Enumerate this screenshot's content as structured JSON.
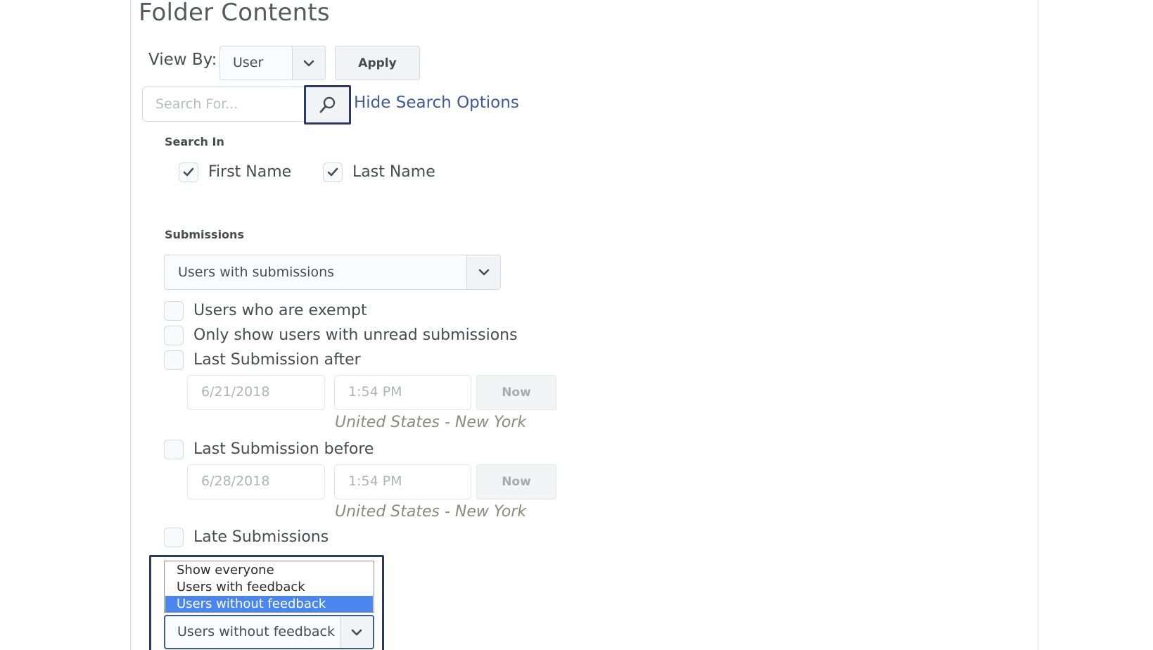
{
  "page": {
    "title": "Folder Contents"
  },
  "view_by": {
    "label": "View By:",
    "selected": "User",
    "apply_label": "Apply"
  },
  "search": {
    "placeholder": "Search For...",
    "hide_options_label": "Hide Search Options"
  },
  "search_in": {
    "label": "Search In",
    "options": [
      {
        "label": "First Name",
        "checked": true
      },
      {
        "label": "Last Name",
        "checked": true
      }
    ]
  },
  "submissions": {
    "label": "Submissions",
    "selected": "Users with submissions"
  },
  "filters": {
    "exempt_label": "Users who are exempt",
    "unread_label": "Only show users with unread submissions",
    "after_label": "Last Submission after",
    "after_date": "6/21/2018",
    "after_time": "1:54 PM",
    "after_now": "Now",
    "after_timezone": "United States - New York",
    "before_label": "Last Submission before",
    "before_date": "6/28/2018",
    "before_time": "1:54 PM",
    "before_now": "Now",
    "before_timezone": "United States - New York",
    "late_label": "Late Submissions"
  },
  "feedback": {
    "options": [
      "Show everyone",
      "Users with feedback",
      "Users without feedback"
    ],
    "highlighted": "Users without feedback",
    "selected": "Users without feedback"
  },
  "icons": {
    "chevron": "chevron-down-icon",
    "search": "search-icon",
    "check": "checkmark-icon"
  },
  "colors": {
    "link": "#3d5a99",
    "focus": "#2d3b61",
    "option_highlight": "#4a86f0"
  }
}
